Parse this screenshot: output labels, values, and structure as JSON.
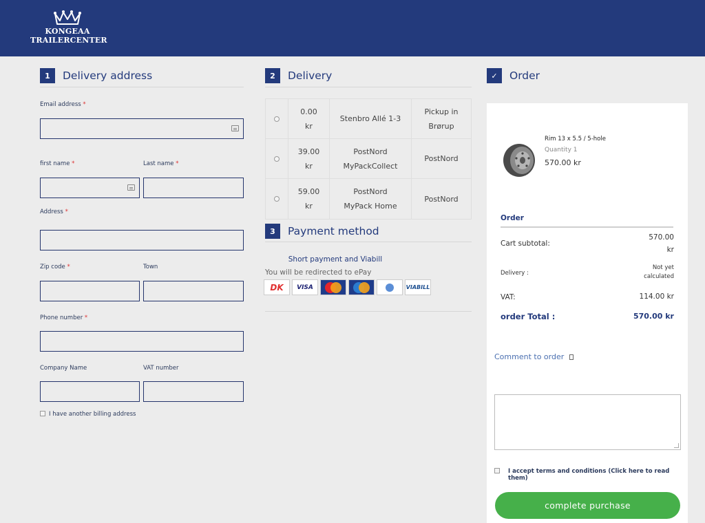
{
  "brand": {
    "line1": "KONGEAA",
    "line2": "TRAILERCENTER"
  },
  "delivery_address": {
    "step": "1",
    "title": "Delivery address",
    "email_label": "Email address",
    "first_name_label": "first name",
    "last_name_label": "Last name",
    "address_label": "Address",
    "zip_label": "Zip code",
    "town_label": "Town",
    "phone_label": "Phone number",
    "company_label": "Company Name",
    "vat_label": "VAT number",
    "required_mark": "*",
    "billing_checkbox_label": "I have another billing address"
  },
  "delivery": {
    "step": "2",
    "title": "Delivery",
    "options": [
      {
        "price": "0.00",
        "currency": "kr",
        "name": "Stenbro Allé 1-3",
        "carrier_line1": "Pickup in",
        "carrier_line2": "Brørup"
      },
      {
        "price": "39.00",
        "currency": "kr",
        "name_line1": "PostNord",
        "name_line2": "MyPackCollect",
        "carrier": "PostNord"
      },
      {
        "price": "59.00",
        "currency": "kr",
        "name_line1": "PostNord",
        "name_line2": "MyPack Home",
        "carrier": "PostNord"
      }
    ]
  },
  "payment": {
    "step": "3",
    "title": "Payment method",
    "option_title": "Short payment and Viabill",
    "option_subtitle": "You will be redirected to ePay",
    "cards": [
      "DK",
      "VISA",
      "MasterCard",
      "Maestro",
      "MobilePay",
      "VIABILL"
    ]
  },
  "order": {
    "step": "✓",
    "title": "Order",
    "product": {
      "name": "Rim 13 x 5.5 / 5-hole",
      "quantity": "Quantity 1",
      "price": "570.00 kr"
    },
    "summary_title": "Order",
    "subtotal_label": "Cart subtotal:",
    "subtotal_value_1": "570.00",
    "subtotal_value_2": "kr",
    "delivery_label": "Delivery :",
    "delivery_value_1": "Not yet",
    "delivery_value_2": "calculated",
    "vat_label": "VAT:",
    "vat_value": "114.00 kr",
    "total_label": "order Total :",
    "total_value": "570.00 kr",
    "comment_label": "Comment to order",
    "terms_label": "I accept terms and conditions (Click here to read them)",
    "submit_label": "complete purchase"
  }
}
